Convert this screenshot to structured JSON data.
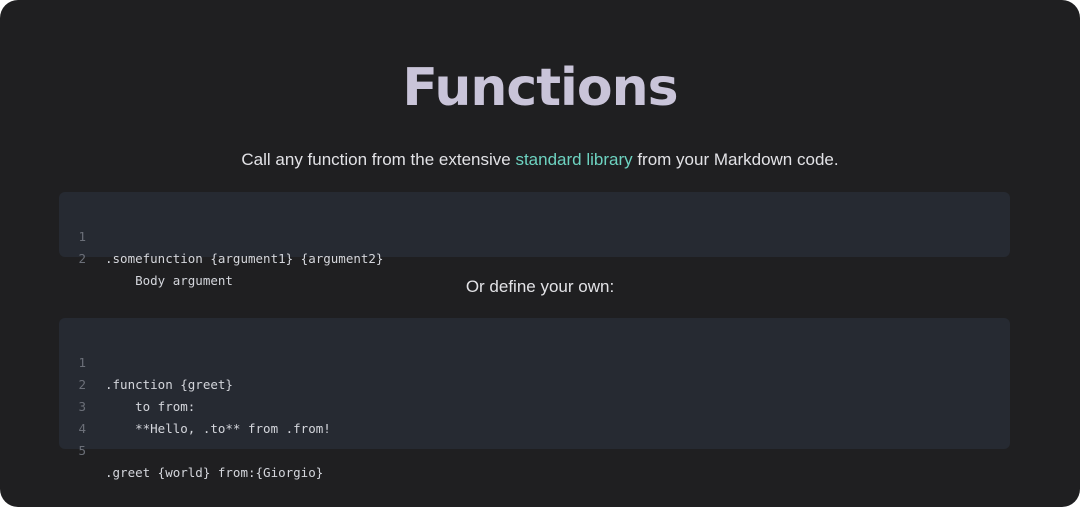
{
  "page": {
    "title": "Functions",
    "intro": {
      "before": "Call any function from the extensive ",
      "link": "standard library",
      "after": " from your Markdown code."
    },
    "define_text": "Or define your own:"
  },
  "code_block_1": {
    "lines": [
      {
        "num": "1",
        "code": ".somefunction {argument1} {argument2}"
      },
      {
        "num": "2",
        "code": "    Body argument"
      }
    ]
  },
  "code_block_2": {
    "lines": [
      {
        "num": "1",
        "code": ".function {greet}"
      },
      {
        "num": "2",
        "code": "    to from:"
      },
      {
        "num": "3",
        "code": "    **Hello, .to** from .from!"
      },
      {
        "num": "4",
        "code": ""
      },
      {
        "num": "5",
        "code": ".greet {world} from:{Giorgio}"
      }
    ]
  },
  "colors": {
    "background": "#1f1f21",
    "title": "#c9c4d9",
    "link": "#6dd2c0",
    "code_background": "#262a32",
    "line_number": "#6b6f78"
  }
}
